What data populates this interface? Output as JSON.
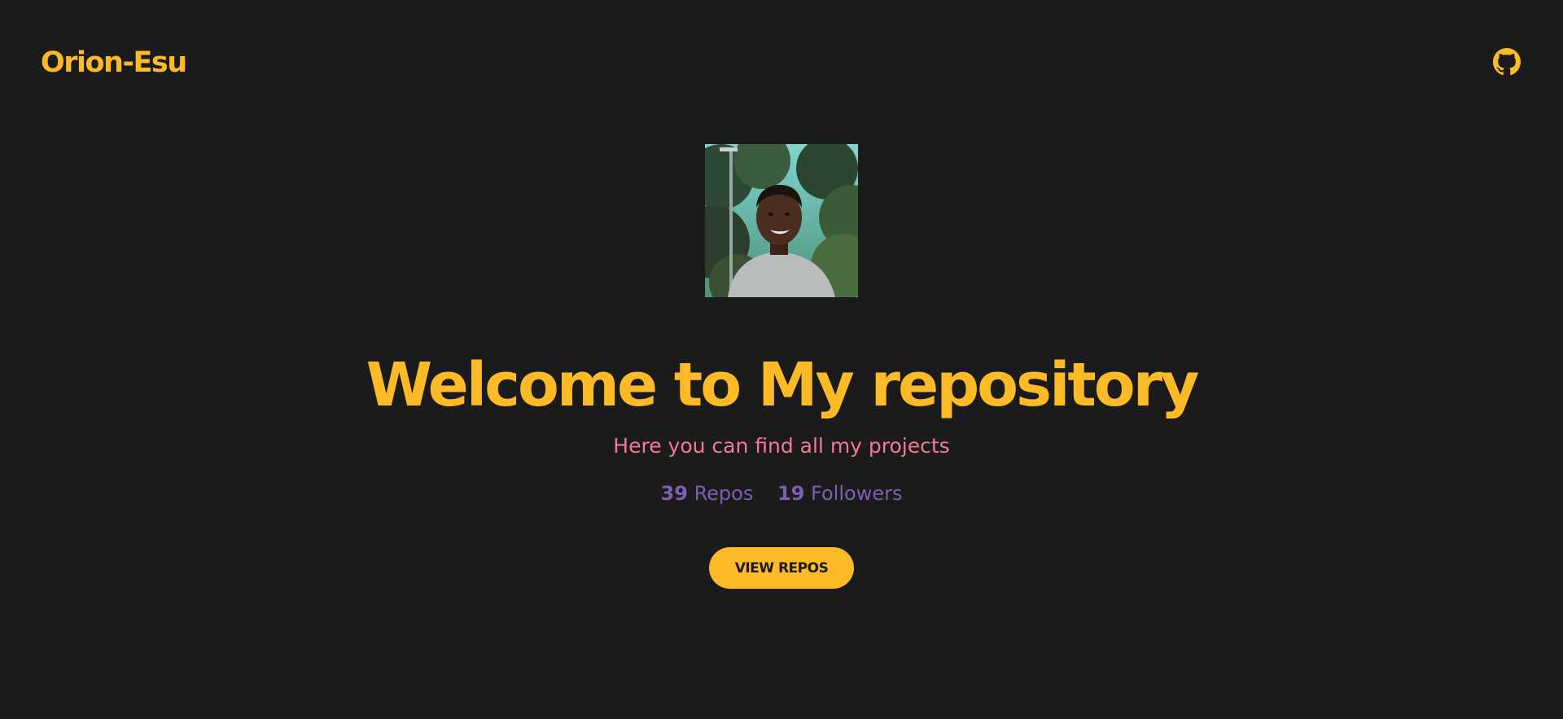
{
  "header": {
    "brand": "Orion-Esu",
    "github_icon": "github-icon"
  },
  "profile": {
    "avatar_alt": "profile photo"
  },
  "hero": {
    "title": "Welcome to My repository",
    "subtitle": "Here you can find all my projects"
  },
  "stats": {
    "repos_count": "39",
    "repos_label": "Repos",
    "followers_count": "19",
    "followers_label": "Followers"
  },
  "actions": {
    "view_repos_label": "VIEW REPOS"
  },
  "colors": {
    "background": "#1b1b1b",
    "accent": "#fcbb26",
    "subtitle": "#f37799",
    "stats": "#7b5fb3"
  }
}
